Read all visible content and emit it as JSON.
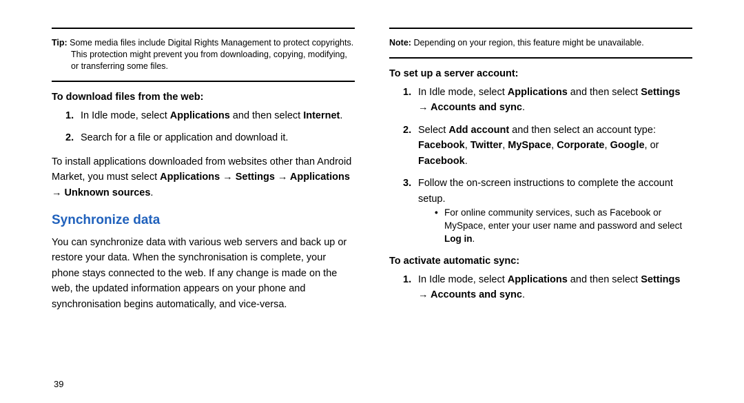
{
  "left": {
    "tip": {
      "label": "Tip:",
      "text": "Some media files include Digital Rights Management to protect copyrights. This protection might prevent you from downloading, copying, modifying, or transferring some files."
    },
    "downloadHeading": "To download files from the web:",
    "step1": {
      "num": "1.",
      "pre": "In Idle mode, select ",
      "b1": "Applications",
      "mid": " and then select ",
      "b2": "Internet",
      "post": "."
    },
    "step2": {
      "num": "2.",
      "text": "Search for a file or application and download it."
    },
    "install": {
      "pre": "To install applications downloaded from websites other than Android Market, you must select ",
      "b1": "Applications → Settings → Applications → Unknown sources",
      "post": "."
    },
    "syncHeading": "Synchronize data",
    "syncBody": "You can synchronize data with various web servers and back up or restore your data. When the synchronisation is complete, your phone stays connected to the web. If any change is made on the web, the updated information appears on your phone and synchronisation begins automatically, and vice-versa."
  },
  "right": {
    "note": {
      "label": "Note:",
      "text": "Depending on your region, this feature might be unavailable."
    },
    "setupHeading": "To set up a server account:",
    "s1": {
      "num": "1.",
      "pre": "In Idle mode, select ",
      "b1": "Applications",
      "mid": " and then select ",
      "b2": "Settings → Accounts and sync",
      "post": "."
    },
    "s2": {
      "num": "2.",
      "pre": "Select ",
      "b1": "Add account",
      "mid": " and then select an account type: ",
      "b2": "Facebook",
      "c1": ", ",
      "b3": "Twitter",
      "c2": ", ",
      "b4": "MySpace",
      "c3": ", ",
      "b5": "Corporate",
      "c4": ", ",
      "b6": "Google",
      "c5": ", or ",
      "b7": "Facebook",
      "post": "."
    },
    "s3": {
      "num": "3.",
      "text": "Follow the on-screen instructions to complete the account setup."
    },
    "bullet": {
      "pre": "For online community services, such as Facebook or MySpace, enter your user name and password and select ",
      "b1": "Log in",
      "post": "."
    },
    "autoSyncHeading": "To activate automatic sync:",
    "a1": {
      "num": "1.",
      "pre": "In Idle mode, select ",
      "b1": "Applications",
      "mid": " and then select ",
      "b2": "Settings → Accounts and sync",
      "post": "."
    }
  },
  "pageNumber": "39"
}
